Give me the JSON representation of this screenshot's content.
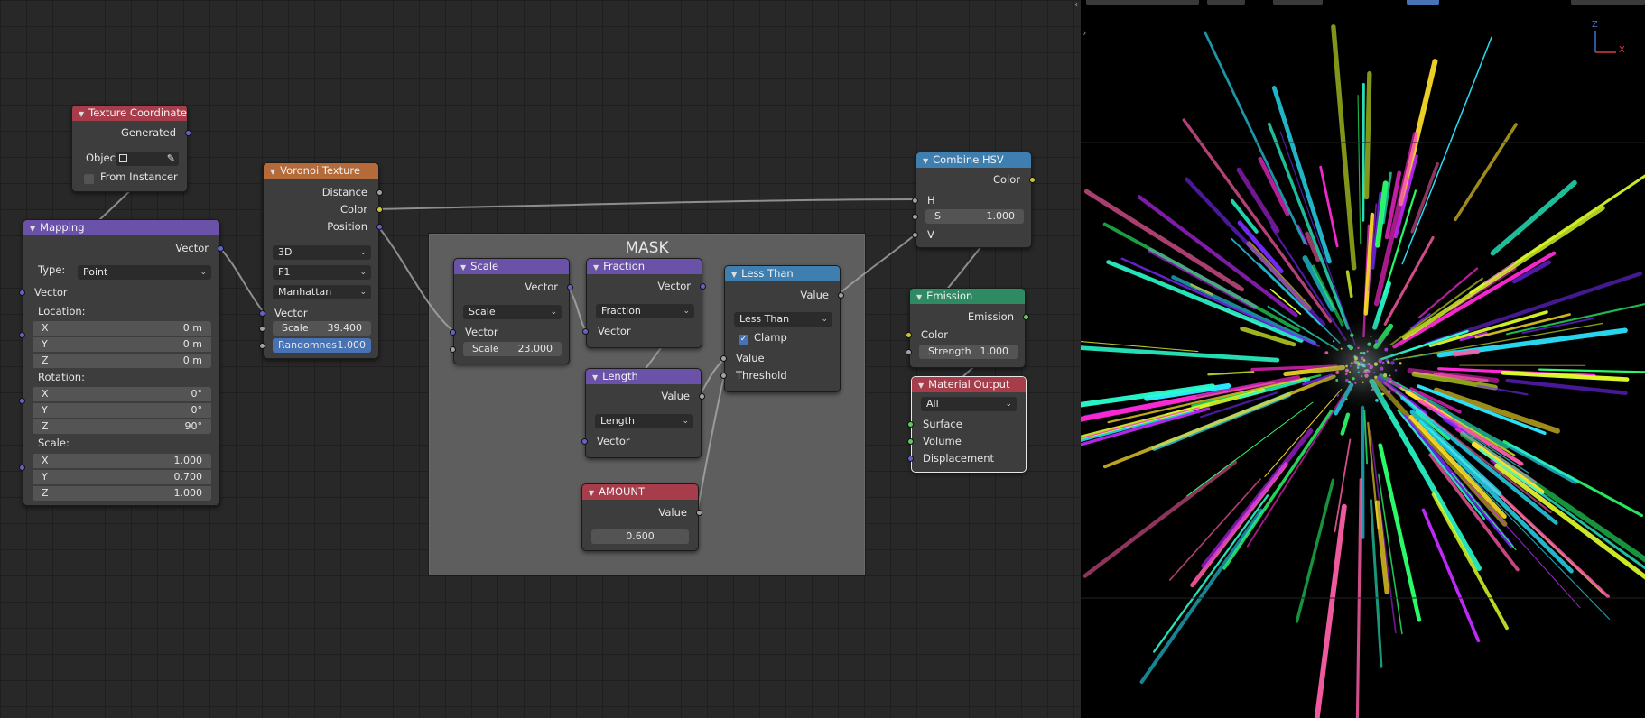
{
  "frame": {
    "label": "MASK"
  },
  "texture_coordinate": {
    "title": "Texture Coordinate",
    "out_generated": "Generated",
    "object_label": "Objec",
    "from_instancer": "From Instancer"
  },
  "mapping": {
    "title": "Mapping",
    "out_vector": "Vector",
    "type_label": "Type:",
    "type_value": "Point",
    "in_vector": "Vector",
    "location_label": "Location:",
    "location": [
      {
        "axis": "X",
        "value": "0 m"
      },
      {
        "axis": "Y",
        "value": "0 m"
      },
      {
        "axis": "Z",
        "value": "0 m"
      }
    ],
    "rotation_label": "Rotation:",
    "rotation": [
      {
        "axis": "X",
        "value": "0°"
      },
      {
        "axis": "Y",
        "value": "0°"
      },
      {
        "axis": "Z",
        "value": "90°"
      }
    ],
    "scale_label": "Scale:",
    "scale": [
      {
        "axis": "X",
        "value": "1.000"
      },
      {
        "axis": "Y",
        "value": "0.700"
      },
      {
        "axis": "Z",
        "value": "1.000"
      }
    ]
  },
  "voronoi": {
    "title": "Voronoi Texture",
    "out_distance": "Distance",
    "out_color": "Color",
    "out_position": "Position",
    "dimension": "3D",
    "feature": "F1",
    "metric": "Manhattan",
    "in_vector": "Vector",
    "scale_label": "Scale",
    "scale_value": "39.400",
    "randomness_label": "Randomnes",
    "randomness_value": "1.000"
  },
  "scale_node": {
    "title": "Scale",
    "out_vector": "Vector",
    "operation": "Scale",
    "in_vector": "Vector",
    "scale_label": "Scale",
    "scale_value": "23.000"
  },
  "fraction_node": {
    "title": "Fraction",
    "out_vector": "Vector",
    "operation": "Fraction",
    "in_vector": "Vector"
  },
  "length_node": {
    "title": "Length",
    "out_value": "Value",
    "operation": "Length",
    "in_vector": "Vector"
  },
  "less_than": {
    "title": "Less Than",
    "out_value": "Value",
    "operation": "Less Than",
    "clamp": "Clamp",
    "in_value": "Value",
    "in_threshold": "Threshold"
  },
  "amount": {
    "title": "AMOUNT",
    "out_value": "Value",
    "value": "0.600"
  },
  "combine_hsv": {
    "title": "Combine HSV",
    "out_color": "Color",
    "in_h": "H",
    "s_label": "S",
    "s_value": "1.000",
    "in_v": "V"
  },
  "emission": {
    "title": "Emission",
    "out_emission": "Emission",
    "in_color": "Color",
    "strength_label": "Strength",
    "strength_value": "1.000"
  },
  "material_output": {
    "title": "Material Output",
    "target": "All",
    "in_surface": "Surface",
    "in_volume": "Volume",
    "in_displacement": "Displacement"
  },
  "viewport": {
    "gizmo_z": "Z",
    "gizmo_x": "X"
  },
  "colors": {
    "vector_socket": "#6363c7",
    "color_socket": "#c7c729",
    "value_socket": "#a1a1a1",
    "shader_socket": "#63c763",
    "header_input": "#a73d4a",
    "header_texture": "#b56a3a",
    "header_vector": "#6a52a8",
    "header_converter": "#3e7fb0",
    "header_shader": "#2e8a62"
  }
}
